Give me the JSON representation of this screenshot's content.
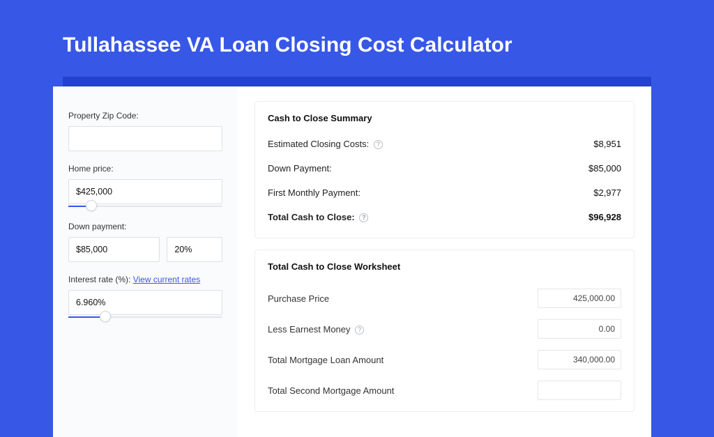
{
  "page_title": "Tullahassee VA Loan Closing Cost Calculator",
  "left": {
    "zip_label": "Property Zip Code:",
    "zip_value": "",
    "home_price_label": "Home price:",
    "home_price_value": "$425,000",
    "home_price_fill_pct": 15,
    "down_label": "Down payment:",
    "down_value": "$85,000",
    "down_pct_value": "20%",
    "rate_label": "Interest rate (%): ",
    "rate_link": "View current rates",
    "rate_value": "6.960%",
    "rate_fill_pct": 24
  },
  "summary": {
    "title": "Cash to Close Summary",
    "rows": [
      {
        "label": "Estimated Closing Costs:",
        "help": true,
        "value": "$8,951",
        "bold": false
      },
      {
        "label": "Down Payment:",
        "help": false,
        "value": "$85,000",
        "bold": false
      },
      {
        "label": "First Monthly Payment:",
        "help": false,
        "value": "$2,977",
        "bold": false
      },
      {
        "label": "Total Cash to Close:",
        "help": true,
        "value": "$96,928",
        "bold": true
      }
    ]
  },
  "worksheet": {
    "title": "Total Cash to Close Worksheet",
    "rows": [
      {
        "label": "Purchase Price",
        "help": false,
        "value": "425,000.00"
      },
      {
        "label": "Less Earnest Money",
        "help": true,
        "value": "0.00"
      },
      {
        "label": "Total Mortgage Loan Amount",
        "help": false,
        "value": "340,000.00"
      },
      {
        "label": "Total Second Mortgage Amount",
        "help": false,
        "value": ""
      }
    ]
  }
}
